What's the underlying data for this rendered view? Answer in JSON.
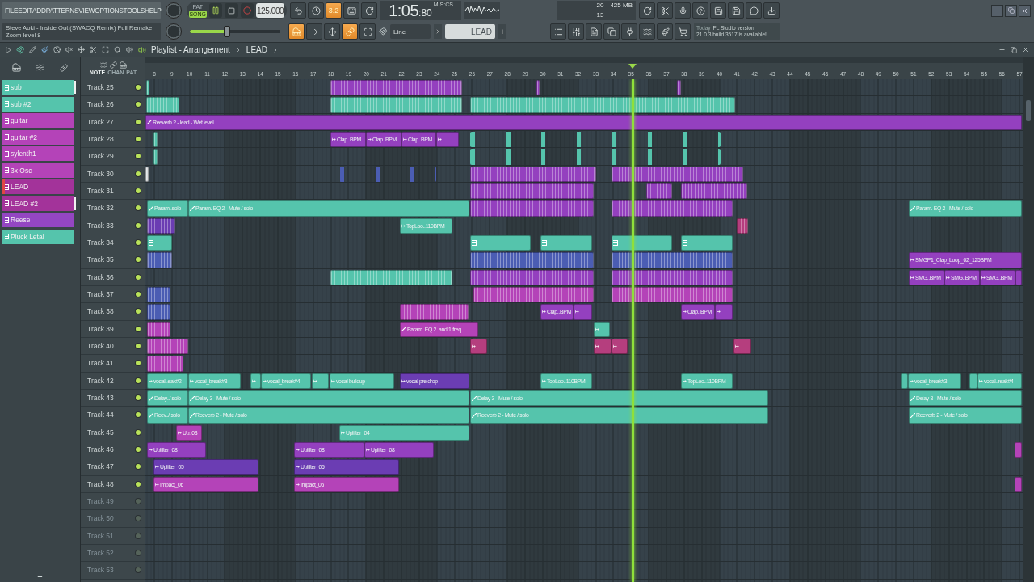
{
  "menu": [
    {
      "label": "FILE"
    },
    {
      "label": "EDIT"
    },
    {
      "label": "ADD"
    },
    {
      "label": "PATTERNS"
    },
    {
      "label": "VIEW"
    },
    {
      "label": "OPTIONS"
    },
    {
      "label": "TOOLS"
    },
    {
      "label": "HELP"
    }
  ],
  "hint_panel": {
    "title": "Steve Aoki - Inside Out (SWACQ Remix) Full Remake",
    "subtitle": "Zoom level 8"
  },
  "transport": {
    "modes": [
      {
        "label": "PAT",
        "selected": false
      },
      {
        "label": "SONG",
        "selected": true
      }
    ],
    "playing": true,
    "tempo": "125.000"
  },
  "record_buttons": [
    {
      "on": false
    },
    {
      "on": false
    },
    {
      "on": true,
      "label": "3.2"
    },
    {
      "on": false
    },
    {
      "on": false
    }
  ],
  "tool_buttons": [
    {
      "on": true
    },
    {
      "on": false
    },
    {
      "on": false
    },
    {
      "on": true
    },
    {
      "on": false
    }
  ],
  "time": {
    "value": "1:05",
    "fraction": ":80",
    "unit": "M:S:CS"
  },
  "cpu": {
    "polyphony": "20",
    "memory": "425 MB",
    "voices": "13"
  },
  "master_volume": {
    "level": 0.41
  },
  "snap": "Line",
  "pattern": "LEAD",
  "news": {
    "date": "Today",
    "title": "FL Studio version",
    "body": "21.0.3 build 3517 is available!"
  },
  "playlist": {
    "title": "Playlist - Arrangement",
    "current": "LEAD"
  },
  "track_tabs": [
    {
      "label": "NOTE",
      "selected": true
    },
    {
      "label": "CHAN",
      "selected": false
    },
    {
      "label": "PAT",
      "selected": false
    }
  ],
  "channels": [
    {
      "name": "sub",
      "color": "#55c4ac",
      "selected": true,
      "focused": false
    },
    {
      "name": "sub #2",
      "color": "#55c4ac",
      "selected": false,
      "focused": false
    },
    {
      "name": "guitar",
      "color": "#b443b8",
      "selected": false,
      "focused": false
    },
    {
      "name": "guitar #2",
      "color": "#b443b8",
      "selected": false,
      "focused": false
    },
    {
      "name": "sylenth1",
      "color": "#b443b8",
      "selected": false,
      "focused": false
    },
    {
      "name": "3x Osc",
      "color": "#b443b8",
      "selected": false,
      "focused": false
    },
    {
      "name": "LEAD",
      "color": "#a3339a",
      "selected": false,
      "focused": true
    },
    {
      "name": "LEAD #2",
      "color": "#a3339a",
      "selected": true,
      "focused": false
    },
    {
      "name": "Reese",
      "color": "#9446c2",
      "selected": false,
      "focused": false
    },
    {
      "name": "Pluck Letal",
      "color": "#55c4ac",
      "selected": false,
      "focused": false
    }
  ],
  "ruler": [
    "8",
    "9",
    "10",
    "11",
    "12",
    "13",
    "14",
    "15",
    "16",
    "17",
    "18",
    "19",
    "20",
    "21",
    "22",
    "23",
    "24",
    "25",
    "26",
    "27",
    "28",
    "29",
    "30",
    "31",
    "32",
    "33",
    "34",
    "35",
    "36",
    "37",
    "38",
    "39",
    "40",
    "41",
    "42",
    "43",
    "44",
    "45",
    "46",
    "47",
    "48",
    "49",
    "50",
    "51",
    "52",
    "53",
    "54",
    "55",
    "56",
    "57"
  ],
  "tracks": [
    {
      "name": "Track 25",
      "dimmed": false,
      "clips": [
        {
          "kind": "notes",
          "color": "#55c4ac"
        },
        {
          "kind": "notes",
          "color": "#9440bf"
        },
        {
          "kind": "notes",
          "color": "#9440bf"
        },
        {
          "kind": "notes",
          "color": "#9440bf"
        }
      ]
    },
    {
      "name": "Track 26",
      "dimmed": false,
      "clips": [
        {
          "kind": "notes",
          "color": "#55c4ac"
        },
        {
          "kind": "notes",
          "color": "#55c4ac"
        },
        {
          "kind": "notes",
          "color": "#55c4ac"
        }
      ]
    },
    {
      "name": "Track 27",
      "dimmed": false,
      "clips": [
        {
          "kind": "automation",
          "color": "#9440bf",
          "label": "Reeverb 2 - lead - Wet level"
        }
      ]
    },
    {
      "name": "Track 28",
      "dimmed": false,
      "clips": [
        {
          "kind": "notes",
          "color": "#55c4ac"
        },
        {
          "kind": "audio",
          "color": "#9440bf",
          "label": "Clap..BPM"
        },
        {
          "kind": "audio",
          "color": "#9440bf",
          "label": "Clap..BPM"
        },
        {
          "kind": "audio",
          "color": "#9440bf",
          "label": "Clap..BPM"
        },
        {
          "kind": "audio",
          "color": "#9440bf"
        },
        {
          "kind": "ticks",
          "color": "#55c4ac"
        }
      ]
    },
    {
      "name": "Track 29",
      "dimmed": false,
      "clips": [
        {
          "kind": "notes",
          "color": "#55c4ac"
        },
        {
          "kind": "ticks",
          "color": "#55c4ac"
        }
      ]
    },
    {
      "name": "Track 30",
      "dimmed": false,
      "clips": [
        {
          "kind": "notes",
          "color": "#d8dde0"
        },
        {
          "kind": "ticks",
          "color": "#4b5db3"
        },
        {
          "kind": "notes",
          "color": "#9440bf"
        },
        {
          "kind": "notes",
          "color": "#9440bf"
        }
      ]
    },
    {
      "name": "Track 31",
      "dimmed": false,
      "clips": [
        {
          "kind": "notes",
          "color": "#9440bf"
        },
        {
          "kind": "notes",
          "color": "#9440bf"
        },
        {
          "kind": "notes",
          "color": "#9440bf"
        }
      ]
    },
    {
      "name": "Track 32",
      "dimmed": false,
      "clips": [
        {
          "kind": "automation",
          "color": "#55c4ac",
          "label": "Param..solo"
        },
        {
          "kind": "automation",
          "color": "#55c4ac",
          "label": "Param. EQ 2 - Mute / solo"
        },
        {
          "kind": "notes",
          "color": "#9440bf"
        },
        {
          "kind": "notes",
          "color": "#9440bf"
        },
        {
          "kind": "automation",
          "color": "#55c4ac",
          "label": "Param. EQ 2 - Mute / solo"
        }
      ]
    },
    {
      "name": "Track 33",
      "dimmed": false,
      "clips": [
        {
          "kind": "notes",
          "color": "#6b3db3"
        },
        {
          "kind": "audio",
          "color": "#55c4ac",
          "label": "TopLoo..110BPM"
        },
        {
          "kind": "notes",
          "color": "#b53e7e"
        }
      ]
    },
    {
      "name": "Track 34",
      "dimmed": false,
      "clips": [
        {
          "kind": "pattern",
          "color": "#55c4ac"
        },
        {
          "kind": "pattern",
          "color": "#55c4ac"
        },
        {
          "kind": "pattern",
          "color": "#55c4ac"
        },
        {
          "kind": "pattern",
          "color": "#55c4ac"
        },
        {
          "kind": "pattern",
          "color": "#55c4ac"
        }
      ]
    },
    {
      "name": "Track 35",
      "dimmed": false,
      "clips": [
        {
          "kind": "notes",
          "color": "#4b5db3"
        },
        {
          "kind": "notes",
          "color": "#4b5db3"
        },
        {
          "kind": "notes",
          "color": "#4b5db3"
        },
        {
          "kind": "audio",
          "color": "#9440bf",
          "label": "SMGP1_Clap_Loop_02_125BPM"
        }
      ]
    },
    {
      "name": "Track 36",
      "dimmed": false,
      "clips": [
        {
          "kind": "notes",
          "color": "#55c4ac"
        },
        {
          "kind": "notes",
          "color": "#9440bf"
        },
        {
          "kind": "notes",
          "color": "#9440bf"
        },
        {
          "kind": "audio",
          "color": "#9440bf",
          "label": "SMG..BPM"
        },
        {
          "kind": "audio",
          "color": "#9440bf",
          "label": "SMG..BPM"
        },
        {
          "kind": "audio",
          "color": "#9440bf",
          "label": "SMG..BPM"
        },
        {
          "kind": "audio",
          "color": "#9440bf"
        }
      ]
    },
    {
      "name": "Track 37",
      "dimmed": false,
      "clips": [
        {
          "kind": "notes",
          "color": "#4b5db3"
        },
        {
          "kind": "notes",
          "color": "#b443b8"
        },
        {
          "kind": "notes",
          "color": "#b443b8"
        }
      ]
    },
    {
      "name": "Track 38",
      "dimmed": false,
      "clips": [
        {
          "kind": "notes",
          "color": "#4b5db3"
        },
        {
          "kind": "notes",
          "color": "#b443b8"
        },
        {
          "kind": "audio",
          "color": "#9440bf",
          "label": "Clap..BPM"
        },
        {
          "kind": "audio",
          "color": "#9440bf"
        },
        {
          "kind": "audio",
          "color": "#9440bf",
          "label": "Clap..BPM"
        },
        {
          "kind": "audio",
          "color": "#9440bf"
        }
      ]
    },
    {
      "name": "Track 39",
      "dimmed": false,
      "clips": [
        {
          "kind": "notes",
          "color": "#b443b8"
        },
        {
          "kind": "automation",
          "color": "#b443b8",
          "label": "Param. EQ 2..and 1 freq"
        },
        {
          "kind": "audio",
          "color": "#55c4ac"
        }
      ]
    },
    {
      "name": "Track 40",
      "dimmed": false,
      "clips": [
        {
          "kind": "notes",
          "color": "#b443b8"
        },
        {
          "kind": "audio",
          "color": "#b53e7e"
        },
        {
          "kind": "audio",
          "color": "#b53e7e"
        },
        {
          "kind": "audio",
          "color": "#b53e7e"
        },
        {
          "kind": "audio",
          "color": "#b53e7e"
        }
      ]
    },
    {
      "name": "Track 41",
      "dimmed": false,
      "clips": [
        {
          "kind": "notes",
          "color": "#b443b8"
        }
      ]
    },
    {
      "name": "Track 42",
      "dimmed": false,
      "clips": [
        {
          "kind": "audio",
          "color": "#55c4ac",
          "label": "vocal..eak#2"
        },
        {
          "kind": "audio",
          "color": "#55c4ac",
          "label": "vocal_break#3"
        },
        {
          "kind": "audio",
          "color": "#55c4ac"
        },
        {
          "kind": "audio",
          "color": "#55c4ac",
          "label": "vocal_break#4"
        },
        {
          "kind": "audio",
          "color": "#55c4ac"
        },
        {
          "kind": "audio",
          "color": "#55c4ac",
          "label": "vocal buildup"
        },
        {
          "kind": "audio",
          "color": "#6b3db3",
          "label": "vocal pre drop"
        },
        {
          "kind": "audio",
          "color": "#55c4ac",
          "label": "TopLoo..110BPM"
        },
        {
          "kind": "audio",
          "color": "#55c4ac",
          "label": "TopLoo..110BPM"
        },
        {
          "kind": "audio",
          "color": "#55c4ac"
        },
        {
          "kind": "audio",
          "color": "#55c4ac",
          "label": "vocal_break#3"
        },
        {
          "kind": "audio",
          "color": "#55c4ac"
        },
        {
          "kind": "audio",
          "color": "#55c4ac",
          "label": "vocal..reak#4"
        }
      ]
    },
    {
      "name": "Track 43",
      "dimmed": false,
      "clips": [
        {
          "kind": "automation",
          "color": "#55c4ac",
          "label": "Delay../ solo"
        },
        {
          "kind": "automation",
          "color": "#55c4ac",
          "label": "Delay 3 - Mute / solo"
        },
        {
          "kind": "automation",
          "color": "#55c4ac",
          "label": "Delay 3 - Mute / solo"
        },
        {
          "kind": "automation",
          "color": "#55c4ac",
          "label": "Delay 3 - Mute / solo"
        }
      ]
    },
    {
      "name": "Track 44",
      "dimmed": false,
      "clips": [
        {
          "kind": "automation",
          "color": "#55c4ac",
          "label": "Reev../ solo"
        },
        {
          "kind": "automation",
          "color": "#55c4ac",
          "label": "Reeverb 2 - Mute / solo"
        },
        {
          "kind": "automation",
          "color": "#55c4ac",
          "label": "Reeverb 2 - Mute / solo"
        },
        {
          "kind": "automation",
          "color": "#55c4ac",
          "label": "Reeverb 2 - Mute / solo"
        }
      ]
    },
    {
      "name": "Track 45",
      "dimmed": false,
      "clips": [
        {
          "kind": "audio",
          "color": "#b443b8",
          "label": "Up..03"
        },
        {
          "kind": "audio",
          "color": "#55c4ac",
          "label": "Uplifter_04"
        }
      ]
    },
    {
      "name": "Track 46",
      "dimmed": false,
      "clips": [
        {
          "kind": "audio",
          "color": "#9440bf",
          "label": "Uplifter_08"
        },
        {
          "kind": "audio",
          "color": "#9440bf",
          "label": "Uplifter_08"
        },
        {
          "kind": "audio",
          "color": "#9440bf",
          "label": "Uplifter_08"
        },
        {
          "kind": "audio",
          "color": "#b443b8"
        }
      ]
    },
    {
      "name": "Track 47",
      "dimmed": false,
      "clips": [
        {
          "kind": "audio",
          "color": "#6b3db3",
          "label": "Uplifter_05"
        },
        {
          "kind": "audio",
          "color": "#6b3db3",
          "label": "Uplifter_05"
        }
      ]
    },
    {
      "name": "Track 48",
      "dimmed": false,
      "clips": [
        {
          "kind": "audio",
          "color": "#b443b8",
          "label": "Impact_06"
        },
        {
          "kind": "audio",
          "color": "#b443b8",
          "label": "Impact_06"
        },
        {
          "kind": "audio",
          "color": "#b443b8"
        }
      ]
    },
    {
      "name": "Track 49",
      "dimmed": true
    },
    {
      "name": "Track 50",
      "dimmed": true
    },
    {
      "name": "Track 51",
      "dimmed": true
    },
    {
      "name": "Track 52",
      "dimmed": true
    },
    {
      "name": "Track 53",
      "dimmed": true
    }
  ],
  "add_button": "+"
}
